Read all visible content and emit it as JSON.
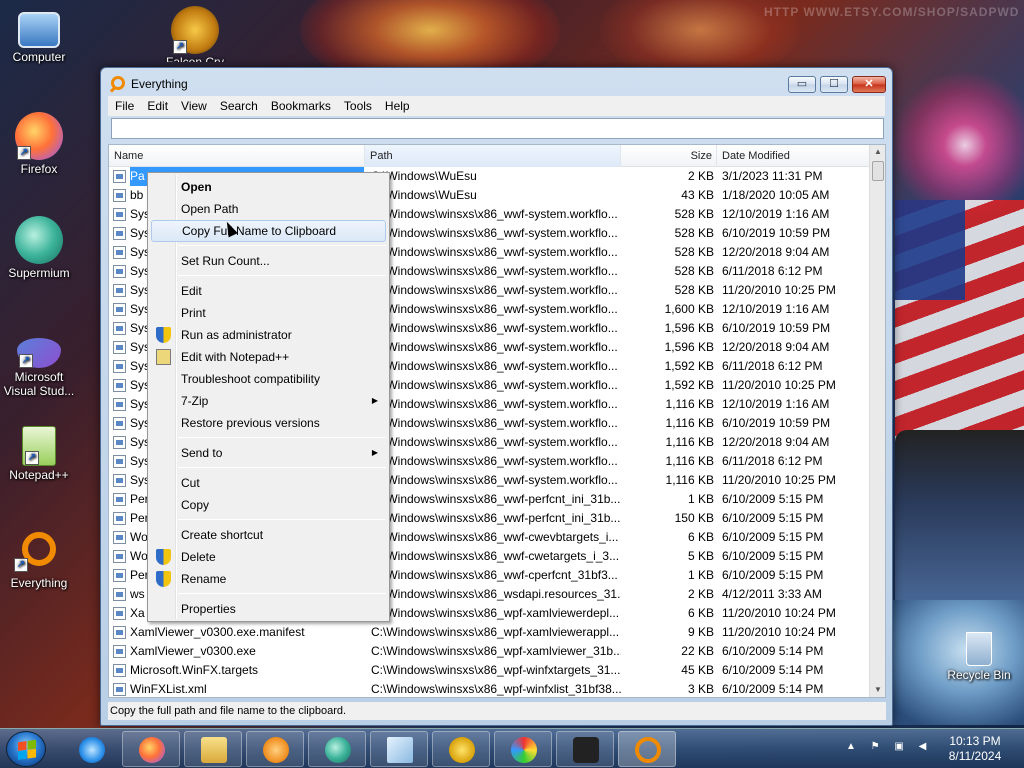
{
  "desktop": {
    "watermark": "HTTP WWW.ETSY.COM/SHOP/SADPWD",
    "icons": [
      {
        "label": "Computer"
      },
      {
        "label": "Falcon Cry"
      },
      {
        "label": "Firefox"
      },
      {
        "label": "Supermium"
      },
      {
        "label": "Microsoft Visual Stud..."
      },
      {
        "label": "Notepad++"
      },
      {
        "label": "Everything"
      },
      {
        "label": "Recycle Bin"
      }
    ]
  },
  "window": {
    "title": "Everything",
    "minimize": "▭",
    "maximize": "☐",
    "close": "✕",
    "menu": [
      "File",
      "Edit",
      "View",
      "Search",
      "Bookmarks",
      "Tools",
      "Help"
    ],
    "search_value": "",
    "columns": {
      "name": "Name",
      "path": "Path",
      "size": "Size",
      "date": "Date Modified"
    },
    "rows": [
      {
        "name": "Pa",
        "path": "C:\\Windows\\WuEsu",
        "size": "2 KB",
        "date": "3/1/2023 11:31 PM"
      },
      {
        "name": "bb",
        "path": "C:\\Windows\\WuEsu",
        "size": "43 KB",
        "date": "1/18/2020 10:05 AM"
      },
      {
        "name": "Sys",
        "path": "C:\\Windows\\winsxs\\x86_wwf-system.workflo...",
        "size": "528 KB",
        "date": "12/10/2019 1:16 AM"
      },
      {
        "name": "Sys",
        "path": "C:\\Windows\\winsxs\\x86_wwf-system.workflo...",
        "size": "528 KB",
        "date": "6/10/2019 10:59 PM"
      },
      {
        "name": "Sys",
        "path": "C:\\Windows\\winsxs\\x86_wwf-system.workflo...",
        "size": "528 KB",
        "date": "12/20/2018 9:04 AM"
      },
      {
        "name": "Sys",
        "path": "C:\\Windows\\winsxs\\x86_wwf-system.workflo...",
        "size": "528 KB",
        "date": "6/11/2018 6:12 PM"
      },
      {
        "name": "Sys",
        "path": "C:\\Windows\\winsxs\\x86_wwf-system.workflo...",
        "size": "528 KB",
        "date": "11/20/2010 10:25 PM"
      },
      {
        "name": "Sys",
        "path": "C:\\Windows\\winsxs\\x86_wwf-system.workflo...",
        "size": "1,600 KB",
        "date": "12/10/2019 1:16 AM"
      },
      {
        "name": "Sys",
        "path": "C:\\Windows\\winsxs\\x86_wwf-system.workflo...",
        "size": "1,596 KB",
        "date": "6/10/2019 10:59 PM"
      },
      {
        "name": "Sys",
        "path": "C:\\Windows\\winsxs\\x86_wwf-system.workflo...",
        "size": "1,596 KB",
        "date": "12/20/2018 9:04 AM"
      },
      {
        "name": "Sys",
        "path": "C:\\Windows\\winsxs\\x86_wwf-system.workflo...",
        "size": "1,592 KB",
        "date": "6/11/2018 6:12 PM"
      },
      {
        "name": "Sys",
        "path": "C:\\Windows\\winsxs\\x86_wwf-system.workflo...",
        "size": "1,592 KB",
        "date": "11/20/2010 10:25 PM"
      },
      {
        "name": "Sys",
        "path": "C:\\Windows\\winsxs\\x86_wwf-system.workflo...",
        "size": "1,116 KB",
        "date": "12/10/2019 1:16 AM"
      },
      {
        "name": "Sys",
        "path": "C:\\Windows\\winsxs\\x86_wwf-system.workflo...",
        "size": "1,116 KB",
        "date": "6/10/2019 10:59 PM"
      },
      {
        "name": "Sys",
        "path": "C:\\Windows\\winsxs\\x86_wwf-system.workflo...",
        "size": "1,116 KB",
        "date": "12/20/2018 9:04 AM"
      },
      {
        "name": "Sys",
        "path": "C:\\Windows\\winsxs\\x86_wwf-system.workflo...",
        "size": "1,116 KB",
        "date": "6/11/2018 6:12 PM"
      },
      {
        "name": "Sys",
        "path": "C:\\Windows\\winsxs\\x86_wwf-system.workflo...",
        "size": "1,116 KB",
        "date": "11/20/2010 10:25 PM"
      },
      {
        "name": "Per",
        "path": "C:\\Windows\\winsxs\\x86_wwf-perfcnt_ini_31b...",
        "size": "1 KB",
        "date": "6/10/2009 5:15 PM"
      },
      {
        "name": "Per",
        "path": "C:\\Windows\\winsxs\\x86_wwf-perfcnt_ini_31b...",
        "size": "150 KB",
        "date": "6/10/2009 5:15 PM"
      },
      {
        "name": "Wo",
        "path": "C:\\Windows\\winsxs\\x86_wwf-cwevbtargets_i...",
        "size": "6 KB",
        "date": "6/10/2009 5:15 PM"
      },
      {
        "name": "Wo",
        "path": "C:\\Windows\\winsxs\\x86_wwf-cwetargets_i_3...",
        "size": "5 KB",
        "date": "6/10/2009 5:15 PM"
      },
      {
        "name": "Per",
        "path": "C:\\Windows\\winsxs\\x86_wwf-cperfcnt_31bf3...",
        "size": "1 KB",
        "date": "6/10/2009 5:15 PM"
      },
      {
        "name": "ws",
        "path": "C:\\Windows\\winsxs\\x86_wsdapi.resources_31...",
        "size": "2 KB",
        "date": "4/12/2011 3:33 AM"
      },
      {
        "name": "Xa",
        "path": "C:\\Windows\\winsxs\\x86_wpf-xamlviewerdepl...",
        "size": "6 KB",
        "date": "11/20/2010 10:24 PM"
      },
      {
        "name": "XamlViewer_v0300.exe.manifest",
        "path": "C:\\Windows\\winsxs\\x86_wpf-xamlviewerappl...",
        "size": "9 KB",
        "date": "11/20/2010 10:24 PM"
      },
      {
        "name": "XamlViewer_v0300.exe",
        "path": "C:\\Windows\\winsxs\\x86_wpf-xamlviewer_31b...",
        "size": "22 KB",
        "date": "6/10/2009 5:14 PM"
      },
      {
        "name": "Microsoft.WinFX.targets",
        "path": "C:\\Windows\\winsxs\\x86_wpf-winfxtargets_31...",
        "size": "45 KB",
        "date": "6/10/2009 5:14 PM"
      },
      {
        "name": "WinFXList.xml",
        "path": "C:\\Windows\\winsxs\\x86_wpf-winfxlist_31bf38...",
        "size": "3 KB",
        "date": "6/10/2009 5:14 PM"
      }
    ],
    "status": "Copy the full path and file name to the clipboard."
  },
  "context_menu": {
    "items": [
      {
        "label": "Open"
      },
      {
        "label": "Open Path"
      },
      {
        "label": "Copy Full Name to Clipboard"
      },
      {
        "label": "Set Run Count..."
      },
      {
        "label": "Edit"
      },
      {
        "label": "Print"
      },
      {
        "label": "Run as administrator"
      },
      {
        "label": "Edit with Notepad++"
      },
      {
        "label": "Troubleshoot compatibility"
      },
      {
        "label": "7-Zip"
      },
      {
        "label": "Restore previous versions"
      },
      {
        "label": "Send to"
      },
      {
        "label": "Cut"
      },
      {
        "label": "Copy"
      },
      {
        "label": "Create shortcut"
      },
      {
        "label": "Delete"
      },
      {
        "label": "Rename"
      },
      {
        "label": "Properties"
      }
    ],
    "submenu_arrow": "▶",
    "hovered": "Copy Full Name to Clipboard"
  },
  "taskbar": {
    "clock_time": "10:13 PM",
    "clock_date": "8/11/2024"
  }
}
